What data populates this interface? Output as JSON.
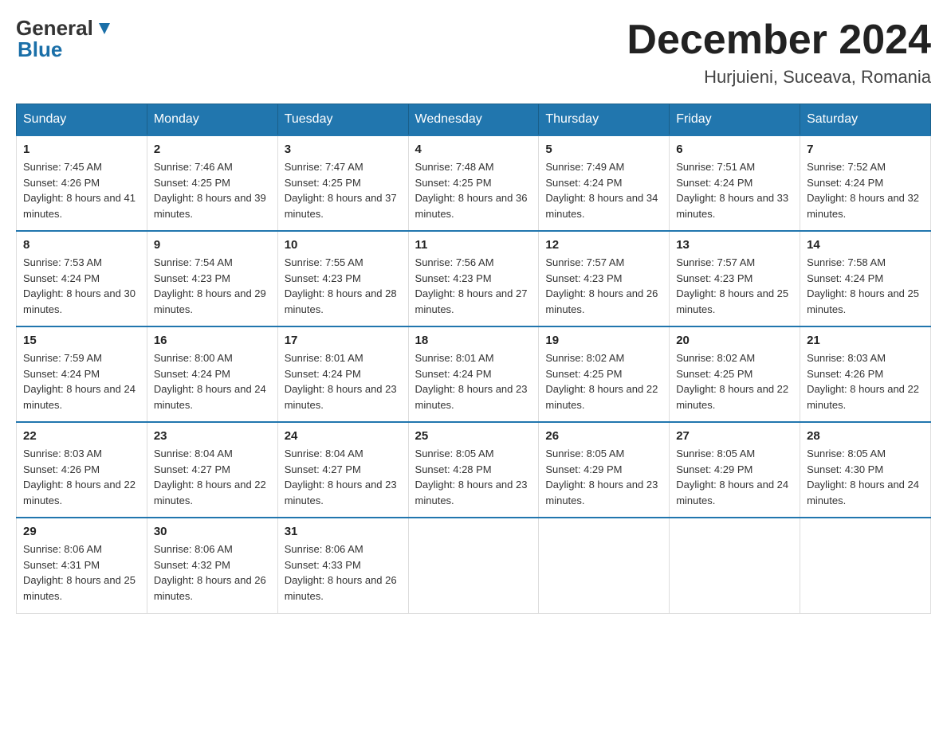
{
  "header": {
    "logo": {
      "general": "General",
      "blue": "Blue"
    },
    "title": "December 2024",
    "location": "Hurjuieni, Suceava, Romania"
  },
  "calendar": {
    "headers": [
      "Sunday",
      "Monday",
      "Tuesday",
      "Wednesday",
      "Thursday",
      "Friday",
      "Saturday"
    ],
    "weeks": [
      [
        {
          "day": "1",
          "sunrise": "7:45 AM",
          "sunset": "4:26 PM",
          "daylight": "8 hours and 41 minutes."
        },
        {
          "day": "2",
          "sunrise": "7:46 AM",
          "sunset": "4:25 PM",
          "daylight": "8 hours and 39 minutes."
        },
        {
          "day": "3",
          "sunrise": "7:47 AM",
          "sunset": "4:25 PM",
          "daylight": "8 hours and 37 minutes."
        },
        {
          "day": "4",
          "sunrise": "7:48 AM",
          "sunset": "4:25 PM",
          "daylight": "8 hours and 36 minutes."
        },
        {
          "day": "5",
          "sunrise": "7:49 AM",
          "sunset": "4:24 PM",
          "daylight": "8 hours and 34 minutes."
        },
        {
          "day": "6",
          "sunrise": "7:51 AM",
          "sunset": "4:24 PM",
          "daylight": "8 hours and 33 minutes."
        },
        {
          "day": "7",
          "sunrise": "7:52 AM",
          "sunset": "4:24 PM",
          "daylight": "8 hours and 32 minutes."
        }
      ],
      [
        {
          "day": "8",
          "sunrise": "7:53 AM",
          "sunset": "4:24 PM",
          "daylight": "8 hours and 30 minutes."
        },
        {
          "day": "9",
          "sunrise": "7:54 AM",
          "sunset": "4:23 PM",
          "daylight": "8 hours and 29 minutes."
        },
        {
          "day": "10",
          "sunrise": "7:55 AM",
          "sunset": "4:23 PM",
          "daylight": "8 hours and 28 minutes."
        },
        {
          "day": "11",
          "sunrise": "7:56 AM",
          "sunset": "4:23 PM",
          "daylight": "8 hours and 27 minutes."
        },
        {
          "day": "12",
          "sunrise": "7:57 AM",
          "sunset": "4:23 PM",
          "daylight": "8 hours and 26 minutes."
        },
        {
          "day": "13",
          "sunrise": "7:57 AM",
          "sunset": "4:23 PM",
          "daylight": "8 hours and 25 minutes."
        },
        {
          "day": "14",
          "sunrise": "7:58 AM",
          "sunset": "4:24 PM",
          "daylight": "8 hours and 25 minutes."
        }
      ],
      [
        {
          "day": "15",
          "sunrise": "7:59 AM",
          "sunset": "4:24 PM",
          "daylight": "8 hours and 24 minutes."
        },
        {
          "day": "16",
          "sunrise": "8:00 AM",
          "sunset": "4:24 PM",
          "daylight": "8 hours and 24 minutes."
        },
        {
          "day": "17",
          "sunrise": "8:01 AM",
          "sunset": "4:24 PM",
          "daylight": "8 hours and 23 minutes."
        },
        {
          "day": "18",
          "sunrise": "8:01 AM",
          "sunset": "4:24 PM",
          "daylight": "8 hours and 23 minutes."
        },
        {
          "day": "19",
          "sunrise": "8:02 AM",
          "sunset": "4:25 PM",
          "daylight": "8 hours and 22 minutes."
        },
        {
          "day": "20",
          "sunrise": "8:02 AM",
          "sunset": "4:25 PM",
          "daylight": "8 hours and 22 minutes."
        },
        {
          "day": "21",
          "sunrise": "8:03 AM",
          "sunset": "4:26 PM",
          "daylight": "8 hours and 22 minutes."
        }
      ],
      [
        {
          "day": "22",
          "sunrise": "8:03 AM",
          "sunset": "4:26 PM",
          "daylight": "8 hours and 22 minutes."
        },
        {
          "day": "23",
          "sunrise": "8:04 AM",
          "sunset": "4:27 PM",
          "daylight": "8 hours and 22 minutes."
        },
        {
          "day": "24",
          "sunrise": "8:04 AM",
          "sunset": "4:27 PM",
          "daylight": "8 hours and 23 minutes."
        },
        {
          "day": "25",
          "sunrise": "8:05 AM",
          "sunset": "4:28 PM",
          "daylight": "8 hours and 23 minutes."
        },
        {
          "day": "26",
          "sunrise": "8:05 AM",
          "sunset": "4:29 PM",
          "daylight": "8 hours and 23 minutes."
        },
        {
          "day": "27",
          "sunrise": "8:05 AM",
          "sunset": "4:29 PM",
          "daylight": "8 hours and 24 minutes."
        },
        {
          "day": "28",
          "sunrise": "8:05 AM",
          "sunset": "4:30 PM",
          "daylight": "8 hours and 24 minutes."
        }
      ],
      [
        {
          "day": "29",
          "sunrise": "8:06 AM",
          "sunset": "4:31 PM",
          "daylight": "8 hours and 25 minutes."
        },
        {
          "day": "30",
          "sunrise": "8:06 AM",
          "sunset": "4:32 PM",
          "daylight": "8 hours and 26 minutes."
        },
        {
          "day": "31",
          "sunrise": "8:06 AM",
          "sunset": "4:33 PM",
          "daylight": "8 hours and 26 minutes."
        },
        null,
        null,
        null,
        null
      ]
    ]
  }
}
